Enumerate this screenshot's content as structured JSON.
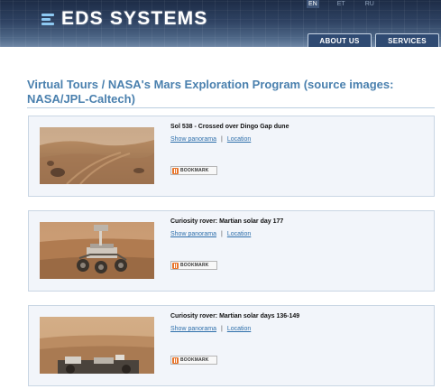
{
  "header": {
    "logo_text": "EDS SYSTEMS",
    "languages": [
      {
        "code": "EN",
        "label": "EN",
        "active": true
      },
      {
        "code": "ET",
        "label": "ET",
        "active": false
      },
      {
        "code": "RU",
        "label": "RU",
        "active": false
      }
    ],
    "nav": {
      "about_label": "ABOUT US",
      "services_label": "SERVICES"
    }
  },
  "main": {
    "page_title": "Virtual Tours / NASA's Mars Exploration Program (source images: NASA/JPL-Caltech)",
    "tours": [
      {
        "title": "Sol 538 - Crossed over Dingo Gap dune",
        "show_panorama": "Show panorama",
        "separator": "|",
        "location": "Location",
        "bookmark_label": "BOOKMARK"
      },
      {
        "title": "Curiosity rover: Martian solar day 177",
        "show_panorama": "Show panorama",
        "separator": "|",
        "location": "Location",
        "bookmark_label": "BOOKMARK"
      },
      {
        "title": "Curiosity rover: Martian solar days 136-149",
        "show_panorama": "Show panorama",
        "separator": "|",
        "location": "Location",
        "bookmark_label": "BOOKMARK"
      }
    ]
  },
  "colors": {
    "header_dark": "#1d2c46",
    "title_blue": "#4a80ae",
    "link_blue": "#2e6fab",
    "card_bg": "#f2f5fa",
    "bookmark_orange": "#e8742a"
  }
}
